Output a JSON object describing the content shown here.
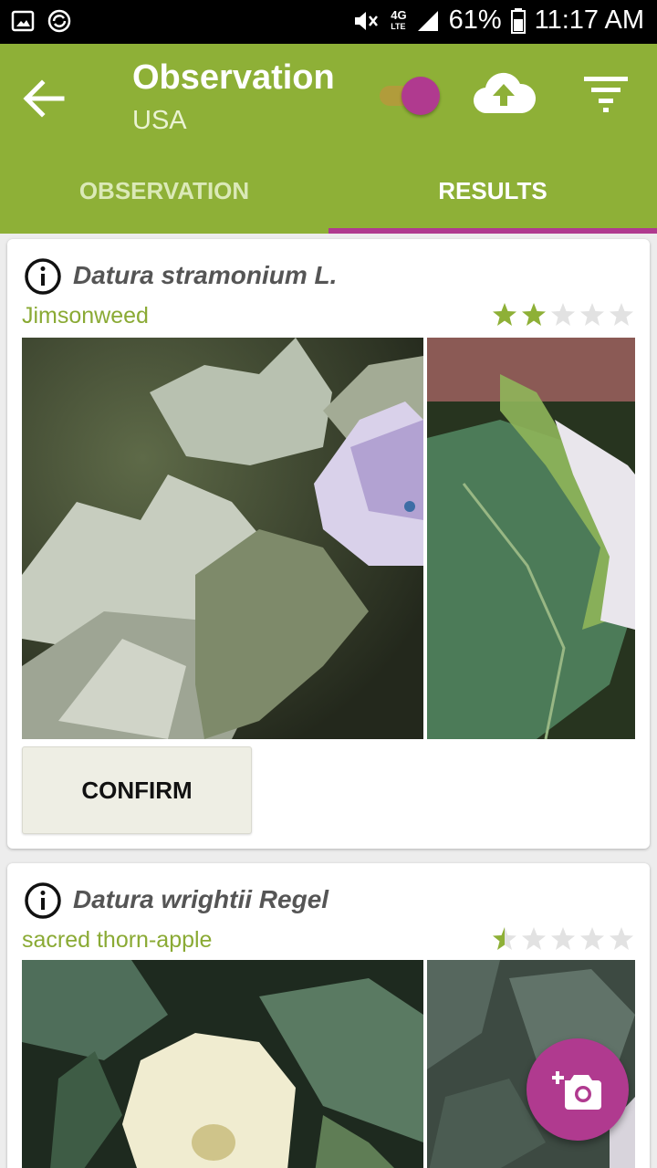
{
  "status_bar": {
    "battery": "61%",
    "time": "11:17 AM",
    "network_label": "4G",
    "network_sublabel": "LTE",
    "icons": [
      "image-notification-icon",
      "sync-notification-icon",
      "mute-icon",
      "signal-icon",
      "battery-icon"
    ]
  },
  "header": {
    "title": "Observation",
    "subtitle": "USA",
    "back_icon": "arrow-left-icon",
    "toggle_on": true,
    "upload_icon": "cloud-upload-icon",
    "filter_icon": "filter-icon"
  },
  "tabs": [
    {
      "label": "OBSERVATION",
      "selected": false
    },
    {
      "label": "RESULTS",
      "selected": true
    }
  ],
  "results": [
    {
      "scientific_name": "Datura stramonium L.",
      "common_name": "Jimsonweed",
      "rating": 2,
      "rating_max": 5,
      "confirm_label": "CONFIRM"
    },
    {
      "scientific_name": "Datura wrightii Regel",
      "common_name": "sacred thorn-apple",
      "rating": 0.5,
      "rating_max": 5
    }
  ],
  "fab": {
    "icon": "add-photo-camera-icon"
  },
  "colors": {
    "primary": "#8eb037",
    "accent": "#b03a8f",
    "star_filled": "#8eb037",
    "star_empty": "#dddddd"
  }
}
